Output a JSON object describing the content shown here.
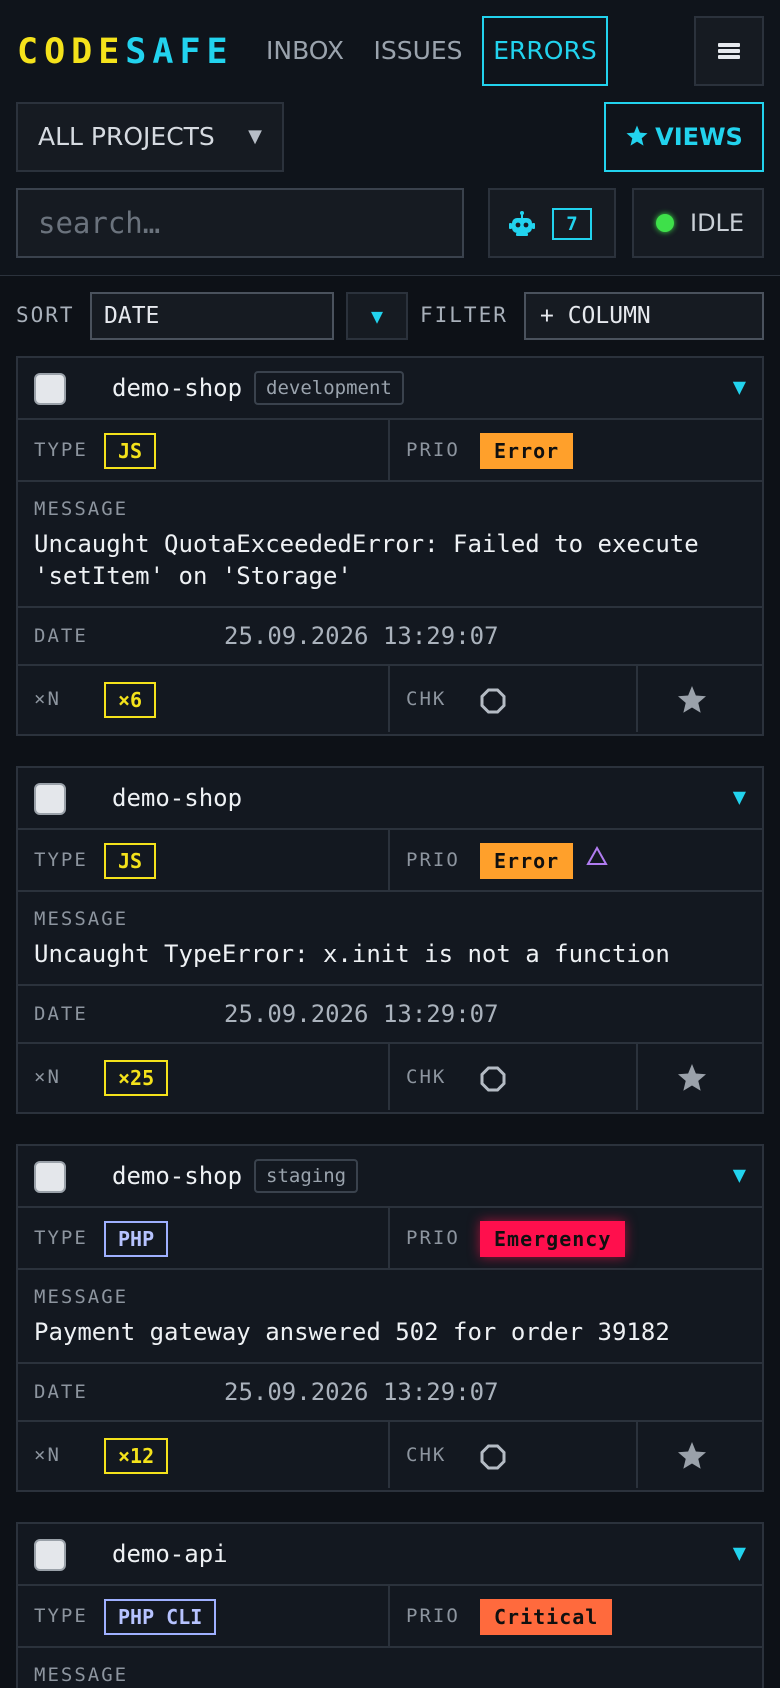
{
  "brand": {
    "part1": "CODE",
    "part2": "SAFE"
  },
  "nav": [
    {
      "label": "INBOX"
    },
    {
      "label": "ISSUES"
    },
    {
      "label": "ERRORS",
      "active": true
    }
  ],
  "toolbar": {
    "projects_label": "ALL PROJECTS",
    "views_label": "VIEWS",
    "search_placeholder": "search…",
    "bot_count": "7",
    "status_label": "IDLE",
    "status_color": "#3ee04a"
  },
  "sortbar": {
    "sort_label": "SORT",
    "sort_value": "DATE",
    "filter_label": "FILTER",
    "column_button": "+ COLUMN"
  },
  "field_labels": {
    "type": "TYPE",
    "prio": "PRIO",
    "message": "MESSAGE",
    "date": "DATE",
    "count": "×N",
    "check": "CHK"
  },
  "errors": [
    {
      "project": "demo-shop",
      "env": "development",
      "type": "JS",
      "priority": "Error",
      "message": "Uncaught QuotaExceededError: Failed to execute 'setItem' on 'Storage'",
      "date": "25.09.2026 13:29:07",
      "count": "×6"
    },
    {
      "project": "demo-shop",
      "env": "",
      "type": "JS",
      "priority": "Error",
      "message": "Uncaught TypeError: x.init is not a function",
      "date": "25.09.2026 13:29:07",
      "count": "×25"
    },
    {
      "project": "demo-shop",
      "env": "staging",
      "type": "PHP",
      "priority": "Emergency",
      "message": "Payment gateway answered 502 for order 39182",
      "date": "25.09.2026 13:29:07",
      "count": "×12"
    },
    {
      "project": "demo-api",
      "env": "",
      "type": "PHP CLI",
      "priority": "Critical",
      "message": "",
      "date": "",
      "count": ""
    }
  ],
  "colors": {
    "accent": "#22d3ee",
    "brand_yellow": "#f4e21b",
    "prio_error": "#ffa02b",
    "prio_emergency": "#ff0f4d",
    "prio_critical": "#ff6a3d"
  }
}
